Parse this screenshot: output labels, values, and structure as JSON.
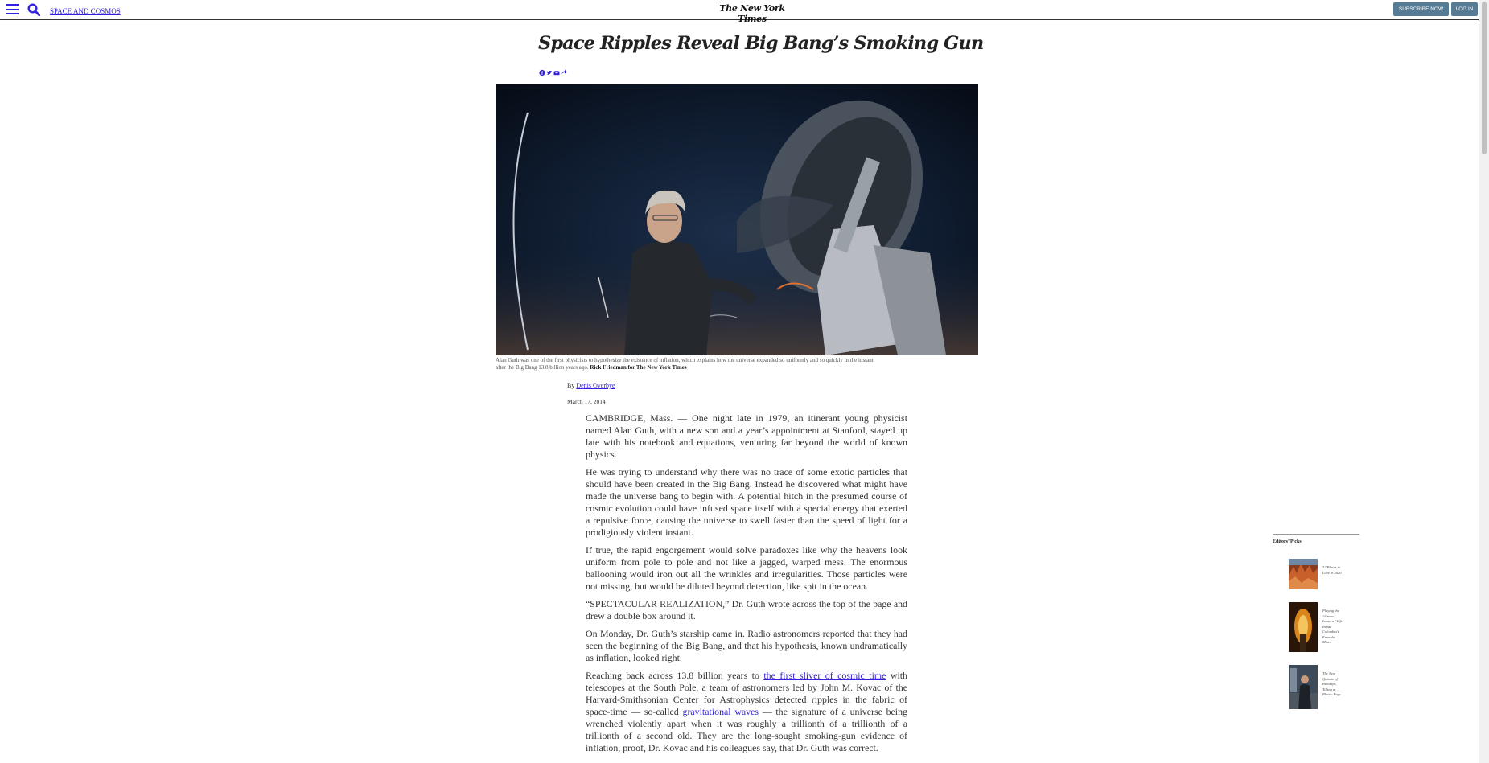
{
  "header": {
    "section_label": "SPACE AND COSMOS",
    "masthead": "The New York Times",
    "subscribe_label": "SUBSCRIBE NOW",
    "login_label": "LOG IN"
  },
  "article": {
    "headline": "Space Ripples Reveal Big Bang’s Smoking Gun",
    "share_icons": [
      "facebook-icon",
      "twitter-icon",
      "email-icon",
      "share-icon"
    ],
    "photo": {
      "caption": "Alan Guth was one of the first physicists to hypothesize the existence of inflation, which explains how the universe expanded so uniformly and so quickly in the instant after the Big Bang 13.8 billion years ago.",
      "credit": "Rick Friedman for The New York Times"
    },
    "byline_prefix": "By",
    "author": "Denis Overbye",
    "date": "March 17, 2014",
    "paragraphs": {
      "p1": "CAMBRIDGE, Mass. — One night late in 1979, an itinerant young physicist named Alan Guth, with a new son and a year’s appointment at Stanford, stayed up late with his notebook and equations, venturing far beyond the world of known physics.",
      "p2": "He was trying to understand why there was no trace of some exotic particles that should have been created in the Big Bang. Instead he discovered what might have made the universe bang to begin with. A potential hitch in the presumed course of cosmic evolution could have infused space itself with a special energy that exerted a repulsive force, causing the universe to swell faster than the speed of light for a prodigiously violent instant.",
      "p3": "If true, the rapid engorgement would solve paradoxes like why the heavens look uniform from pole to pole and not like a jagged, warped mess. The enormous ballooning would iron out all the wrinkles and irregularities. Those particles were not missing, but would be diluted beyond detection, like spit in the ocean.",
      "p4": "“SPECTACULAR REALIZATION,” Dr. Guth wrote across the top of the page and drew a double box around it.",
      "p5": "On Monday, Dr. Guth’s starship came in. Radio astronomers reported that they had seen the beginning of the Big Bang, and that his hypothesis, known undramatically as inflation, looked right.",
      "p6_a": "Reaching back across 13.8 billion years to",
      "p6_link1": "the first sliver of cosmic time",
      "p6_b": "with telescopes at the South Pole, a team of astronomers led by John M. Kovac of the Harvard-Smithsonian Center for Astrophysics detected ripples in the fabric of space-time — so-called",
      "p6_link2": "gravitational waves",
      "p6_c": "— the signature of a universe being wrenched violently apart when it was roughly a trillionth of a trillionth of a trillionth of a second old. They are the long-sought smoking-gun evidence of inflation, proof, Dr. Kovac and his colleagues say, that Dr. Guth was correct."
    }
  },
  "editors_picks": {
    "title": "Editors’ Picks",
    "items": [
      {
        "text": "32 Places to Love in 2020"
      },
      {
        "text": "Playing the “Green Lantern” Life Inside Colombia’s Emerald Mines"
      },
      {
        "text": "The New Quixote of Brooklyn, Tilting at Plastic Bags"
      }
    ]
  },
  "colors": {
    "link": "#3322dd",
    "button_bg": "#567b95",
    "text": "#333333"
  }
}
